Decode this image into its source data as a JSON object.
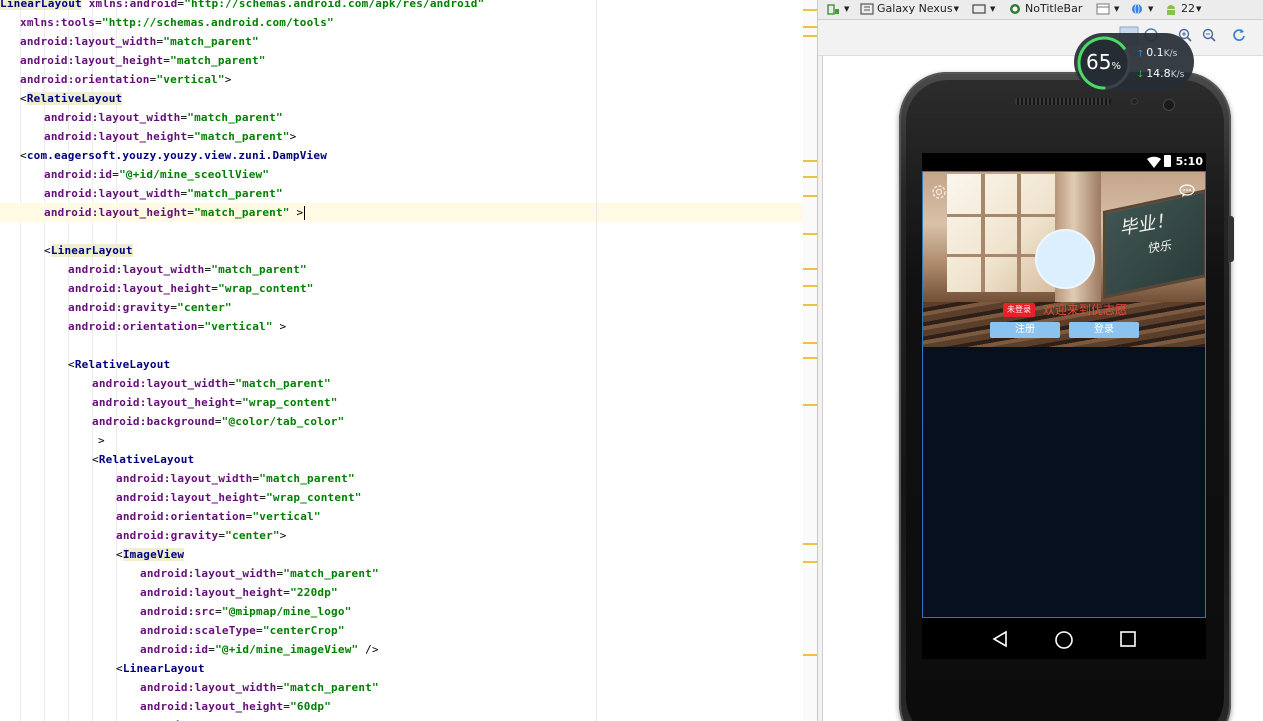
{
  "editor": {
    "lines": [
      [
        [
          "tag",
          "LinearLayout"
        ],
        [
          "pn",
          " "
        ],
        [
          "an",
          "xmlns:android"
        ],
        [
          "pn",
          "="
        ],
        [
          "av",
          "\"http://schemas.android.com/apk/res/android\""
        ]
      ],
      [
        [
          "an",
          "xmlns:tools"
        ],
        [
          "pn",
          "="
        ],
        [
          "av",
          "\"http://schemas.android.com/tools\""
        ]
      ],
      [
        [
          "an",
          "android:layout_width"
        ],
        [
          "pn",
          "="
        ],
        [
          "av",
          "\"match_parent\""
        ]
      ],
      [
        [
          "an",
          "android:layout_height"
        ],
        [
          "pn",
          "="
        ],
        [
          "av",
          "\"match_parent\""
        ]
      ],
      [
        [
          "an",
          "android:orientation"
        ],
        [
          "pn",
          "="
        ],
        [
          "av",
          "\"vertical\""
        ],
        [
          "pn",
          ">"
        ]
      ],
      [
        [
          "pn",
          "<"
        ],
        [
          "tag",
          "RelativeLayout"
        ]
      ],
      [
        [
          "an",
          "android:layout_width"
        ],
        [
          "pn",
          "="
        ],
        [
          "av",
          "\"match_parent\""
        ]
      ],
      [
        [
          "an",
          "android:layout_height"
        ],
        [
          "pn",
          "="
        ],
        [
          "av",
          "\"match_parent\""
        ],
        [
          "pn",
          ">"
        ]
      ],
      [
        [
          "pn",
          "<"
        ],
        [
          "tagn",
          "com.eagersoft.youzy.youzy.view.zuni.DampView"
        ]
      ],
      [
        [
          "an",
          "android:id"
        ],
        [
          "pn",
          "="
        ],
        [
          "av",
          "\"@+id/mine_sceollView\""
        ]
      ],
      [
        [
          "an",
          "android:layout_width"
        ],
        [
          "pn",
          "="
        ],
        [
          "av",
          "\"match_parent\""
        ]
      ],
      [
        [
          "an",
          "android:layout_height"
        ],
        [
          "pn",
          "="
        ],
        [
          "av",
          "\"match_parent\""
        ],
        [
          "pn",
          " >"
        ]
      ],
      [],
      [
        [
          "pn",
          "<"
        ],
        [
          "tag",
          "LinearLayout"
        ]
      ],
      [
        [
          "an",
          "android:layout_width"
        ],
        [
          "pn",
          "="
        ],
        [
          "av",
          "\"match_parent\""
        ]
      ],
      [
        [
          "an",
          "android:layout_height"
        ],
        [
          "pn",
          "="
        ],
        [
          "av",
          "\"wrap_content\""
        ]
      ],
      [
        [
          "an",
          "android:gravity"
        ],
        [
          "pn",
          "="
        ],
        [
          "av",
          "\"center\""
        ]
      ],
      [
        [
          "an",
          "android:orientation"
        ],
        [
          "pn",
          "="
        ],
        [
          "av",
          "\"vertical\""
        ],
        [
          "pn",
          " >"
        ]
      ],
      [],
      [
        [
          "pn",
          "<"
        ],
        [
          "tagn",
          "RelativeLayout"
        ]
      ],
      [
        [
          "an",
          "android:layout_width"
        ],
        [
          "pn",
          "="
        ],
        [
          "av",
          "\"match_parent\""
        ]
      ],
      [
        [
          "an",
          "android:layout_height"
        ],
        [
          "pn",
          "="
        ],
        [
          "av",
          "\"wrap_content\""
        ]
      ],
      [
        [
          "an",
          "android:background"
        ],
        [
          "pn",
          "="
        ],
        [
          "av",
          "\"@color/tab_color\""
        ]
      ],
      [
        [
          "pn",
          ">"
        ]
      ],
      [
        [
          "pn",
          "<"
        ],
        [
          "tagn",
          "RelativeLayout"
        ]
      ],
      [
        [
          "an",
          "android:layout_width"
        ],
        [
          "pn",
          "="
        ],
        [
          "av",
          "\"match_parent\""
        ]
      ],
      [
        [
          "an",
          "android:layout_height"
        ],
        [
          "pn",
          "="
        ],
        [
          "av",
          "\"wrap_content\""
        ]
      ],
      [
        [
          "an",
          "android:orientation"
        ],
        [
          "pn",
          "="
        ],
        [
          "av",
          "\"vertical\""
        ]
      ],
      [
        [
          "an",
          "android:gravity"
        ],
        [
          "pn",
          "="
        ],
        [
          "av",
          "\"center\""
        ],
        [
          "pn",
          ">"
        ]
      ],
      [
        [
          "pn",
          "<"
        ],
        [
          "tag",
          "ImageView"
        ]
      ],
      [
        [
          "an",
          "android:layout_width"
        ],
        [
          "pn",
          "="
        ],
        [
          "av",
          "\"match_parent\""
        ]
      ],
      [
        [
          "an",
          "android:layout_height"
        ],
        [
          "pn",
          "="
        ],
        [
          "av",
          "\"220dp\""
        ]
      ],
      [
        [
          "an",
          "android:src"
        ],
        [
          "pn",
          "="
        ],
        [
          "av",
          "\"@mipmap/mine_logo\""
        ]
      ],
      [
        [
          "an",
          "android:scaleType"
        ],
        [
          "pn",
          "="
        ],
        [
          "av",
          "\"centerCrop\""
        ]
      ],
      [
        [
          "an",
          "android:id"
        ],
        [
          "pn",
          "="
        ],
        [
          "av",
          "\"@+id/mine_imageView\""
        ],
        [
          "pn",
          " />"
        ]
      ],
      [
        [
          "pn",
          "<"
        ],
        [
          "tagn",
          "LinearLayout"
        ]
      ],
      [
        [
          "an",
          "android:layout_width"
        ],
        [
          "pn",
          "="
        ],
        [
          "av",
          "\"match_parent\""
        ]
      ],
      [
        [
          "an",
          "android:layout_height"
        ],
        [
          "pn",
          "="
        ],
        [
          "av",
          "\"60dp\""
        ]
      ],
      [
        [
          "an",
          "android:background"
        ],
        [
          "pn",
          "="
        ],
        [
          "av",
          "\"@color/..\""
        ]
      ]
    ]
  },
  "toolbar": {
    "device": "Galaxy Nexus",
    "theme": "NoTitleBar",
    "api": "22"
  },
  "phone": {
    "status_time": "5:10",
    "badge": "未登录",
    "welcome": "欢迎来到优志愿",
    "register_label": "注册",
    "login_label": "登录",
    "blackboard_text": "毕业！",
    "blackboard_sub": "快乐"
  },
  "network": {
    "percent": "65",
    "percent_unit": "%",
    "upload": "0.1",
    "download": "14.8",
    "unit": "K/s"
  },
  "colors": {
    "tag": "#000080",
    "attribute": "#660e7a",
    "value": "#008000",
    "badge": "#e8202a",
    "button": "#8cc3ee",
    "app_background": "#07101e"
  }
}
